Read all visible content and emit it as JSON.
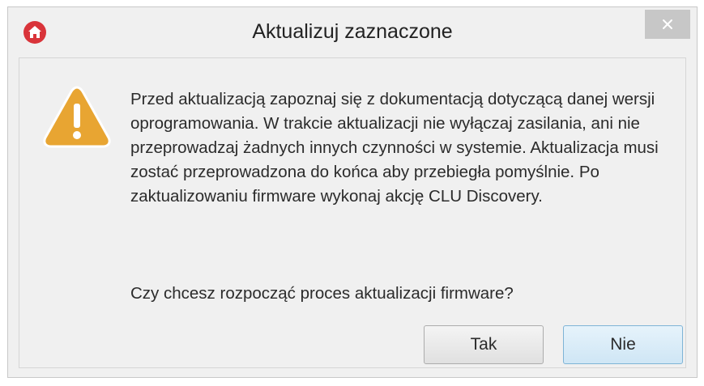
{
  "window": {
    "title": "Aktualizuj zaznaczone",
    "app_icon": "home-icon",
    "close_icon": "close-icon"
  },
  "dialog": {
    "icon": "warning-icon",
    "message": "Przed aktualizacją zapoznaj się z dokumentacją dotyczącą danej wersji oprogramowania. W trakcie aktualizacji nie wyłączaj zasilania, ani nie przeprowadzaj żadnych innych czynności w systemie. Aktualizacja musi zostać przeprowadzona do końca aby przebiegła pomyślnie. Po zaktualizowaniu firmware wykonaj akcję CLU Discovery.",
    "question": "Czy chcesz rozpocząć proces aktualizacji firmware?"
  },
  "buttons": {
    "yes_label": "Tak",
    "no_label": "Nie"
  },
  "colors": {
    "app_icon": "#d9343a",
    "warning": "#e8a532",
    "close_button_bg": "#c7c7c7",
    "default_button_border": "#7eb4d6"
  }
}
